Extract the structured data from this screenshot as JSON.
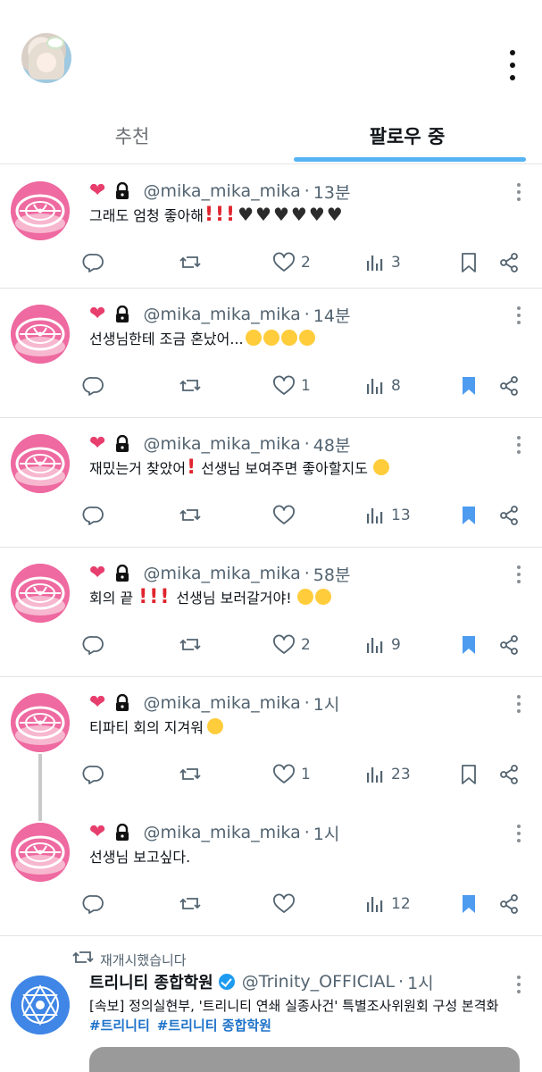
{
  "tabs": {
    "recommended": "추천",
    "following": "팔로우 중"
  },
  "tweets": [
    {
      "handle": "@mika_mika_mika",
      "time": "13분",
      "text": "그래도 엄청 좋아해",
      "likes": "2",
      "views": "3",
      "bookmarked": false
    },
    {
      "handle": "@mika_mika_mika",
      "time": "14분",
      "text": "선생님한테 조금 혼났어...",
      "likes": "1",
      "views": "8",
      "bookmarked": true
    },
    {
      "handle": "@mika_mika_mika",
      "time": "48분",
      "text_a": "재밌는거 찾았어",
      "text_b": "선생님 보여주면 좋아할지도",
      "likes": "",
      "views": "13",
      "bookmarked": true
    },
    {
      "handle": "@mika_mika_mika",
      "time": "58분",
      "text_a": "회의 끝",
      "text_b": "선생님 보러갈거야!",
      "likes": "2",
      "views": "9",
      "bookmarked": true
    },
    {
      "handle": "@mika_mika_mika",
      "time": "1시",
      "text": "티파티 회의 지겨워",
      "likes": "1",
      "views": "23",
      "bookmarked": false
    },
    {
      "handle": "@mika_mika_mika",
      "time": "1시",
      "text": "선생님 보고싶다.",
      "likes": "",
      "views": "12",
      "bookmarked": true
    }
  ],
  "retweet": {
    "label": "재개시했습니다",
    "name": "트리니티 종합학원",
    "handle": "@Trinity_OFFICIAL",
    "time": "1시",
    "text": "[속보] 정의실현부, '트리니티 연쇄 실종사건' 특별조사위원회 구성 본격화",
    "hashtags": [
      "#트리니티",
      "#트리니티 종합학원"
    ]
  },
  "colors": {
    "accent": "#1d9bf0",
    "heart": "#e83e6d",
    "avatar_pink": "#ee6aa0",
    "bookmark_active": "#4d9cf0"
  },
  "icons": [
    "more-vert-icon",
    "heart-icon",
    "lock-icon",
    "reply-icon",
    "retweet-icon",
    "like-icon",
    "views-icon",
    "bookmark-icon",
    "share-icon"
  ]
}
